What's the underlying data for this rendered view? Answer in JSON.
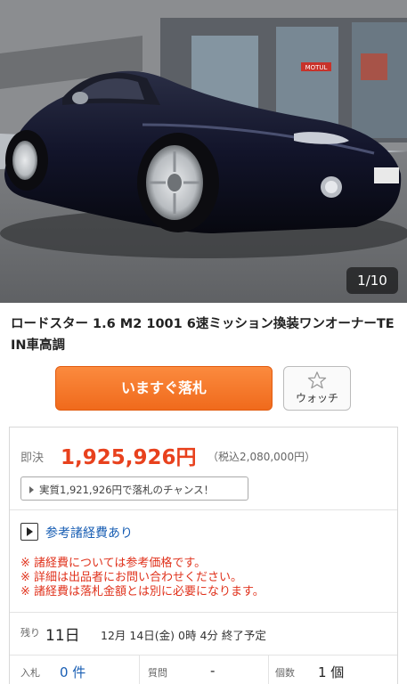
{
  "gallery": {
    "counter": "1/10",
    "sign_text": "MOTUL"
  },
  "listing": {
    "title": "ロードスター 1.6 M2 1001 6速ミッション換装ワンオーナーTEIN車高調"
  },
  "actions": {
    "buy_now_label": "いますぐ落札",
    "watch_label": "ウォッチ"
  },
  "price": {
    "label": "即決",
    "value": "1,925,926円",
    "tax_included": "（税込2,080,000円）",
    "chance_text": "実質1,921,926円で落札のチャンス！"
  },
  "fees": {
    "link_text": "参考諸経費あり",
    "notes": [
      "※ 諸経費については参考価格です。",
      "※ 詳細は出品者にお問い合わせください。",
      "※ 諸経費は落札金額とは別に必要になります。"
    ]
  },
  "remaining": {
    "label": "残り",
    "days": "11日",
    "end_text": "12月 14日(金) 0時 4分 終了予定"
  },
  "stats": {
    "bids_label": "入札",
    "bids_value": "0 件",
    "questions_label": "質問",
    "questions_value": "-",
    "quantity_label": "個数",
    "quantity_value": "1 個"
  },
  "colors": {
    "accent_orange": "#f06a1c",
    "price_red": "#e8411d",
    "link_blue": "#1a5fb4",
    "note_red": "#e0321c"
  }
}
